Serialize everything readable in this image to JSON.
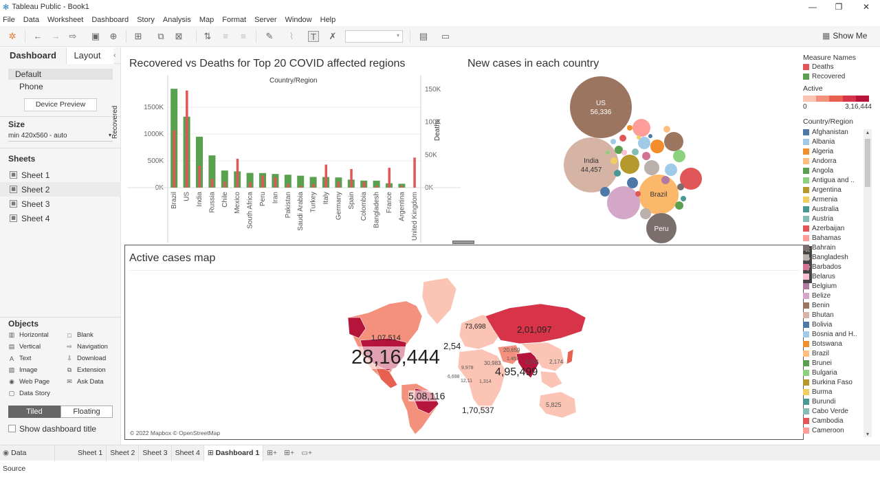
{
  "window": {
    "title": "Tableau Public - Book1",
    "minimize": "—",
    "maximize": "❐",
    "close": "✕"
  },
  "menu": [
    "File",
    "Data",
    "Worksheet",
    "Dashboard",
    "Story",
    "Analysis",
    "Map",
    "Format",
    "Server",
    "Window",
    "Help"
  ],
  "toolbar": {
    "show_me": "Show Me"
  },
  "left_panel": {
    "tab_dashboard": "Dashboard",
    "tab_layout": "Layout",
    "device_default": "Default",
    "device_phone": "Phone",
    "device_preview": "Device Preview",
    "size_heading": "Size",
    "size_value": "min 420x560 - auto",
    "sheets_heading": "Sheets",
    "sheets": [
      "Sheet 1",
      "Sheet 2",
      "Sheet 3",
      "Sheet 4"
    ],
    "objects_heading": "Objects",
    "objects": [
      {
        "label": "Horizontal",
        "icon": "horizontal-icon"
      },
      {
        "label": "Blank",
        "icon": "blank-icon"
      },
      {
        "label": "Vertical",
        "icon": "vertical-icon"
      },
      {
        "label": "Navigation",
        "icon": "navigation-icon"
      },
      {
        "label": "Text",
        "icon": "text-icon"
      },
      {
        "label": "Download",
        "icon": "download-icon"
      },
      {
        "label": "Image",
        "icon": "image-icon"
      },
      {
        "label": "Extension",
        "icon": "extension-icon"
      },
      {
        "label": "Web Page",
        "icon": "web-page-icon"
      },
      {
        "label": "Ask Data",
        "icon": "ask-data-icon"
      },
      {
        "label": "Data Story",
        "icon": "data-story-icon"
      }
    ],
    "tiled": "Tiled",
    "floating": "Floating",
    "show_title": "Show dashboard title"
  },
  "bar_panel": {
    "title": "Recovered vs Deaths for Top 20 COVID affected regions",
    "header": "Country/Region"
  },
  "bubble_panel": {
    "title": "New cases in each country"
  },
  "map_panel": {
    "title": "Active cases map",
    "attribution": "© 2022 Mapbox © OpenStreetMap"
  },
  "legends": {
    "measure_names_title": "Measure Names",
    "measure_names": [
      {
        "label": "Deaths",
        "color": "#e15759"
      },
      {
        "label": "Recovered",
        "color": "#59a14f"
      }
    ],
    "active_title": "Active",
    "active_min": "0",
    "active_max": "3,16,444",
    "active_colors": [
      "#fbc4b4",
      "#f4917c",
      "#e8604f",
      "#d7344a",
      "#b5153b"
    ],
    "country_title": "Country/Region",
    "countries": [
      {
        "label": "Afghanistan",
        "color": "#4e79a7"
      },
      {
        "label": "Albania",
        "color": "#a0cbe8"
      },
      {
        "label": "Algeria",
        "color": "#f28e2b"
      },
      {
        "label": "Andorra",
        "color": "#ffbe7d"
      },
      {
        "label": "Angola",
        "color": "#59a14f"
      },
      {
        "label": "Antigua and ..",
        "color": "#8cd17d"
      },
      {
        "label": "Argentina",
        "color": "#b6992d"
      },
      {
        "label": "Armenia",
        "color": "#f1ce63"
      },
      {
        "label": "Australia",
        "color": "#499894"
      },
      {
        "label": "Austria",
        "color": "#86bcb6"
      },
      {
        "label": "Azerbaijan",
        "color": "#e15759"
      },
      {
        "label": "Bahamas",
        "color": "#ff9d9a"
      },
      {
        "label": "Bahrain",
        "color": "#79706e"
      },
      {
        "label": "Bangladesh",
        "color": "#bab0ac"
      },
      {
        "label": "Barbados",
        "color": "#d37295"
      },
      {
        "label": "Belarus",
        "color": "#fabfd2"
      },
      {
        "label": "Belgium",
        "color": "#b07aa1"
      },
      {
        "label": "Belize",
        "color": "#d4a6c8"
      },
      {
        "label": "Benin",
        "color": "#9d7660"
      },
      {
        "label": "Bhutan",
        "color": "#d7b5a6"
      },
      {
        "label": "Bolivia",
        "color": "#4e79a7"
      },
      {
        "label": "Bosnia and H..",
        "color": "#a0cbe8"
      },
      {
        "label": "Botswana",
        "color": "#f28e2b"
      },
      {
        "label": "Brazil",
        "color": "#ffbe7d"
      },
      {
        "label": "Brunei",
        "color": "#59a14f"
      },
      {
        "label": "Bulgaria",
        "color": "#8cd17d"
      },
      {
        "label": "Burkina Faso",
        "color": "#b6992d"
      },
      {
        "label": "Burma",
        "color": "#f1ce63"
      },
      {
        "label": "Burundi",
        "color": "#499894"
      },
      {
        "label": "Cabo Verde",
        "color": "#86bcb6"
      },
      {
        "label": "Cambodia",
        "color": "#e15759"
      },
      {
        "label": "Cameroon",
        "color": "#ff9d9a"
      }
    ]
  },
  "bubble_data": [
    {
      "label": "US",
      "value": "56,336",
      "color": "#9c7560"
    },
    {
      "label": "India",
      "value": "44,457",
      "color": "#d6b4a5"
    },
    {
      "label": "Brazil",
      "value": "",
      "color": "#fcb86a"
    },
    {
      "label": "Peru",
      "value": "",
      "color": "#7a6f6c"
    }
  ],
  "map_labels": [
    "28,16,444",
    "5,08,116",
    "4,95,499",
    "2,01,097",
    "1,70,537",
    "1,07,514",
    "73,698",
    "2,54",
    "5,825",
    "30,983",
    "3,258",
    "2,174",
    "20,659",
    "1,457",
    "9,978",
    "6,698",
    "12,11",
    "1,314"
  ],
  "statusbar": {
    "data_source": "Data Source",
    "tabs": [
      "Sheet 1",
      "Sheet 2",
      "Sheet 3",
      "Sheet 4",
      "Dashboard 1"
    ]
  },
  "chart_data": {
    "type": "bar",
    "title": "Recovered vs Deaths for Top 20 COVID affected regions",
    "xlabel": "Country/Region",
    "categories": [
      "Brazil",
      "US",
      "India",
      "Russia",
      "Chile",
      "Mexico",
      "South Africa",
      "Peru",
      "Iran",
      "Pakistan",
      "Saudi Arabia",
      "Turkey",
      "Italy",
      "Germany",
      "Spain",
      "Colombia",
      "Bangladesh",
      "France",
      "Argentina",
      "United Kingdom"
    ],
    "series": [
      {
        "name": "Recovered",
        "axis": "left",
        "ylabel": "Recovered",
        "ylim": [
          0,
          1900000
        ],
        "ticks": [
          "0K",
          "500K",
          "1000K",
          "1500K"
        ],
        "values": [
          1846641,
          1325804,
          951166,
          602249,
          319954,
          303810,
          274925,
          272547,
          255144,
          241026,
          222936,
          199417,
          198593,
          190314,
          150376,
          131161,
          130102,
          81212,
          72575,
          1437
        ]
      },
      {
        "name": "Deaths",
        "axis": "right",
        "ylabel": "Deaths",
        "ylim": [
          0,
          155000
        ],
        "ticks": [
          "0K",
          "50K",
          "100K",
          "150K"
        ],
        "values": [
          87618,
          148011,
          33408,
          13334,
          9187,
          44022,
          8153,
          18418,
          15912,
          5842,
          2760,
          5630,
          35112,
          9125,
          28432,
          8777,
          2965,
          30212,
          3055,
          45844
        ]
      }
    ]
  }
}
